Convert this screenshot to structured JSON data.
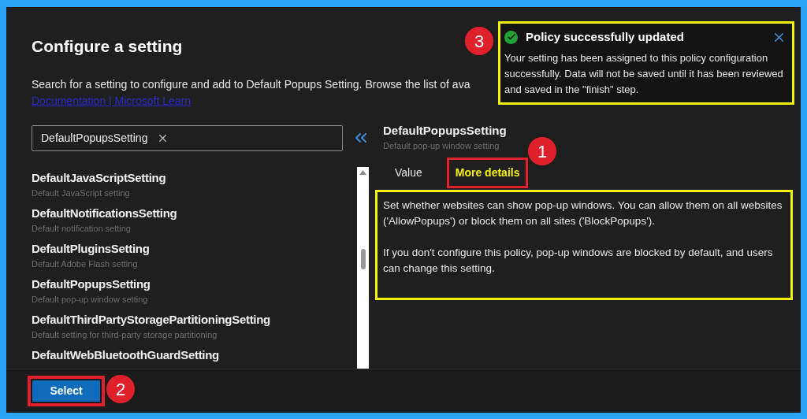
{
  "dialog": {
    "title": "Configure a setting",
    "description": "Search for a setting to configure and add to Default Popups Setting. Browse the list of ava",
    "link": "Documentation | Microsoft Learn"
  },
  "search": {
    "value": "DefaultPopupsSetting"
  },
  "settings": [
    {
      "name": "DefaultJavaScriptSetting",
      "description": "Default JavaScript setting"
    },
    {
      "name": "DefaultNotificationsSetting",
      "description": "Default notification setting"
    },
    {
      "name": "DefaultPluginsSetting",
      "description": "Default Adobe Flash setting"
    },
    {
      "name": "DefaultPopupsSetting",
      "description": "Default pop-up window setting"
    },
    {
      "name": "DefaultThirdPartyStoragePartitioningSetting",
      "description": "Default setting for third-party storage partitioning"
    },
    {
      "name": "DefaultWebBluetoothGuardSetting"
    }
  ],
  "detail": {
    "title": "DefaultPopupsSetting",
    "subtitle": "Default pop-up window setting",
    "tabs": [
      {
        "label": "Value",
        "selected": false
      },
      {
        "label": "More details",
        "selected": true
      }
    ],
    "paragraphs": [
      "Set whether websites can show pop-up windows. You can allow them on all websites ('AllowPopups') or block them on all sites ('BlockPopups').",
      "If you don't configure this policy, pop-up windows are blocked by default, and users can change this setting."
    ]
  },
  "footer": {
    "button": "Select"
  },
  "toast": {
    "title": "Policy successfully updated",
    "message": "Your setting has been assigned to this policy configuration successfully. Data will not be saved until it has been reviewed and saved in the \"finish\" step."
  },
  "callouts": [
    "1",
    "2",
    "3"
  ]
}
